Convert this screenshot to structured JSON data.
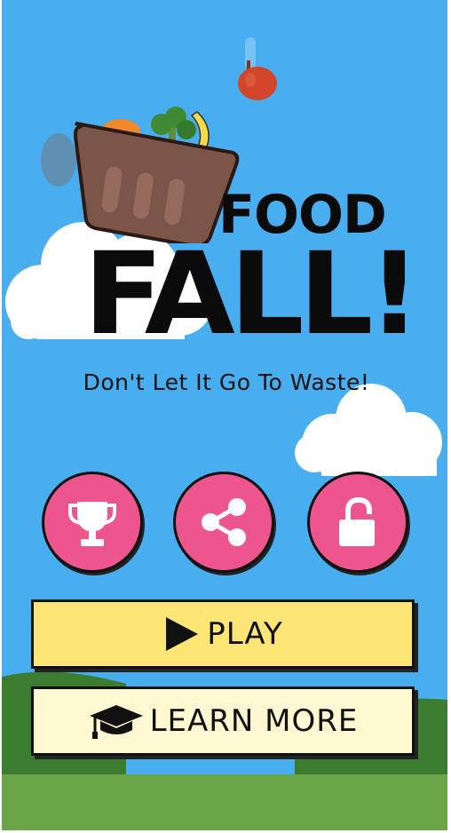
{
  "title": {
    "line1": "FOOD",
    "line2": "FALL!"
  },
  "tagline": "Don't Let It Go To Waste!",
  "icon_buttons": [
    {
      "icon": "trophy-icon",
      "role": "leaderboard"
    },
    {
      "icon": "share-icon",
      "role": "share"
    },
    {
      "icon": "unlock-icon",
      "role": "unlock"
    }
  ],
  "buttons": {
    "play_label": "PLAY",
    "learn_label": "LEARN MORE"
  },
  "colors": {
    "sky": "#48aef0",
    "circle_button": "#ec568d",
    "play_button": "#fde676",
    "learn_button": "#fef8d2",
    "hill_dark": "#3b7c2f",
    "ground": "#6aa547"
  }
}
